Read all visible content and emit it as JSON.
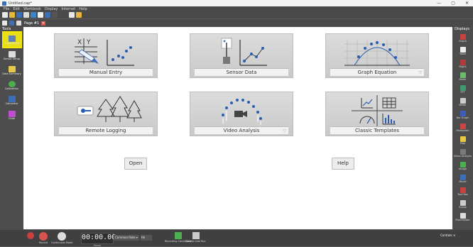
{
  "window": {
    "title": "Untitled.cap*",
    "minimize": "—",
    "maximize": "▢",
    "close": "✕"
  },
  "menu": [
    "File",
    "Edit",
    "Workbook",
    "Display",
    "Internet",
    "Help"
  ],
  "tab": {
    "page_label": "Page #1"
  },
  "tools": {
    "header": "Tools",
    "items": [
      {
        "label": "Experiment",
        "color": "#5f82b8"
      },
      {
        "label": "Sensor Setup",
        "color": "#dddddd"
      },
      {
        "label": "Data Summary",
        "color": "#e6c84a"
      },
      {
        "label": "Calibration",
        "color": "#4caf50"
      },
      {
        "label": "Calculator",
        "color": "#3b6fb6"
      },
      {
        "label": "Code",
        "color": "#c04fd0"
      }
    ]
  },
  "cards": [
    {
      "label": "Manual Entry"
    },
    {
      "label": "Sensor Data"
    },
    {
      "label": "Graph Equation"
    },
    {
      "label": "Remote Logging"
    },
    {
      "label": "Video Analysis"
    },
    {
      "label": "Classic Templates"
    }
  ],
  "buttons": {
    "open": "Open",
    "help": "Help"
  },
  "displays": {
    "header": "Displays",
    "items": [
      {
        "label": "Graph",
        "color": "#c94040"
      },
      {
        "label": "Table",
        "color": "#eeeeee"
      },
      {
        "label": "Digits",
        "color": "#b33a3a"
      },
      {
        "label": "Meter",
        "color": "#6dbb6d"
      },
      {
        "label": "FFT",
        "color": "#3f9b6f"
      },
      {
        "label": "Meter",
        "color": "#cccccc"
      },
      {
        "label": "Bar Graph",
        "color": "#3b5fb6"
      },
      {
        "label": "Histogram",
        "color": "#cc4444"
      },
      {
        "label": "Map",
        "color": "#e8c840"
      },
      {
        "label": "Video Analysis",
        "color": "#7a7a7a"
      },
      {
        "label": "Image",
        "color": "#4caf50"
      },
      {
        "label": "Movie",
        "color": "#3b6fb6"
      },
      {
        "label": "Text Box",
        "color": "#c94040"
      },
      {
        "label": "Scope",
        "color": "#cccccc"
      },
      {
        "label": "Placeholder",
        "color": "#dddddd"
      }
    ]
  },
  "bottom": {
    "record": "Record",
    "continuous": "Continuous Mode",
    "timer": "00:00.00",
    "timer_sub": "Hours",
    "rate": "Common Rate ▾",
    "rate_unit": "Hz",
    "conditions": "Recording Conditions",
    "delete_run": "Delete Last Run",
    "controls": "Controls"
  }
}
